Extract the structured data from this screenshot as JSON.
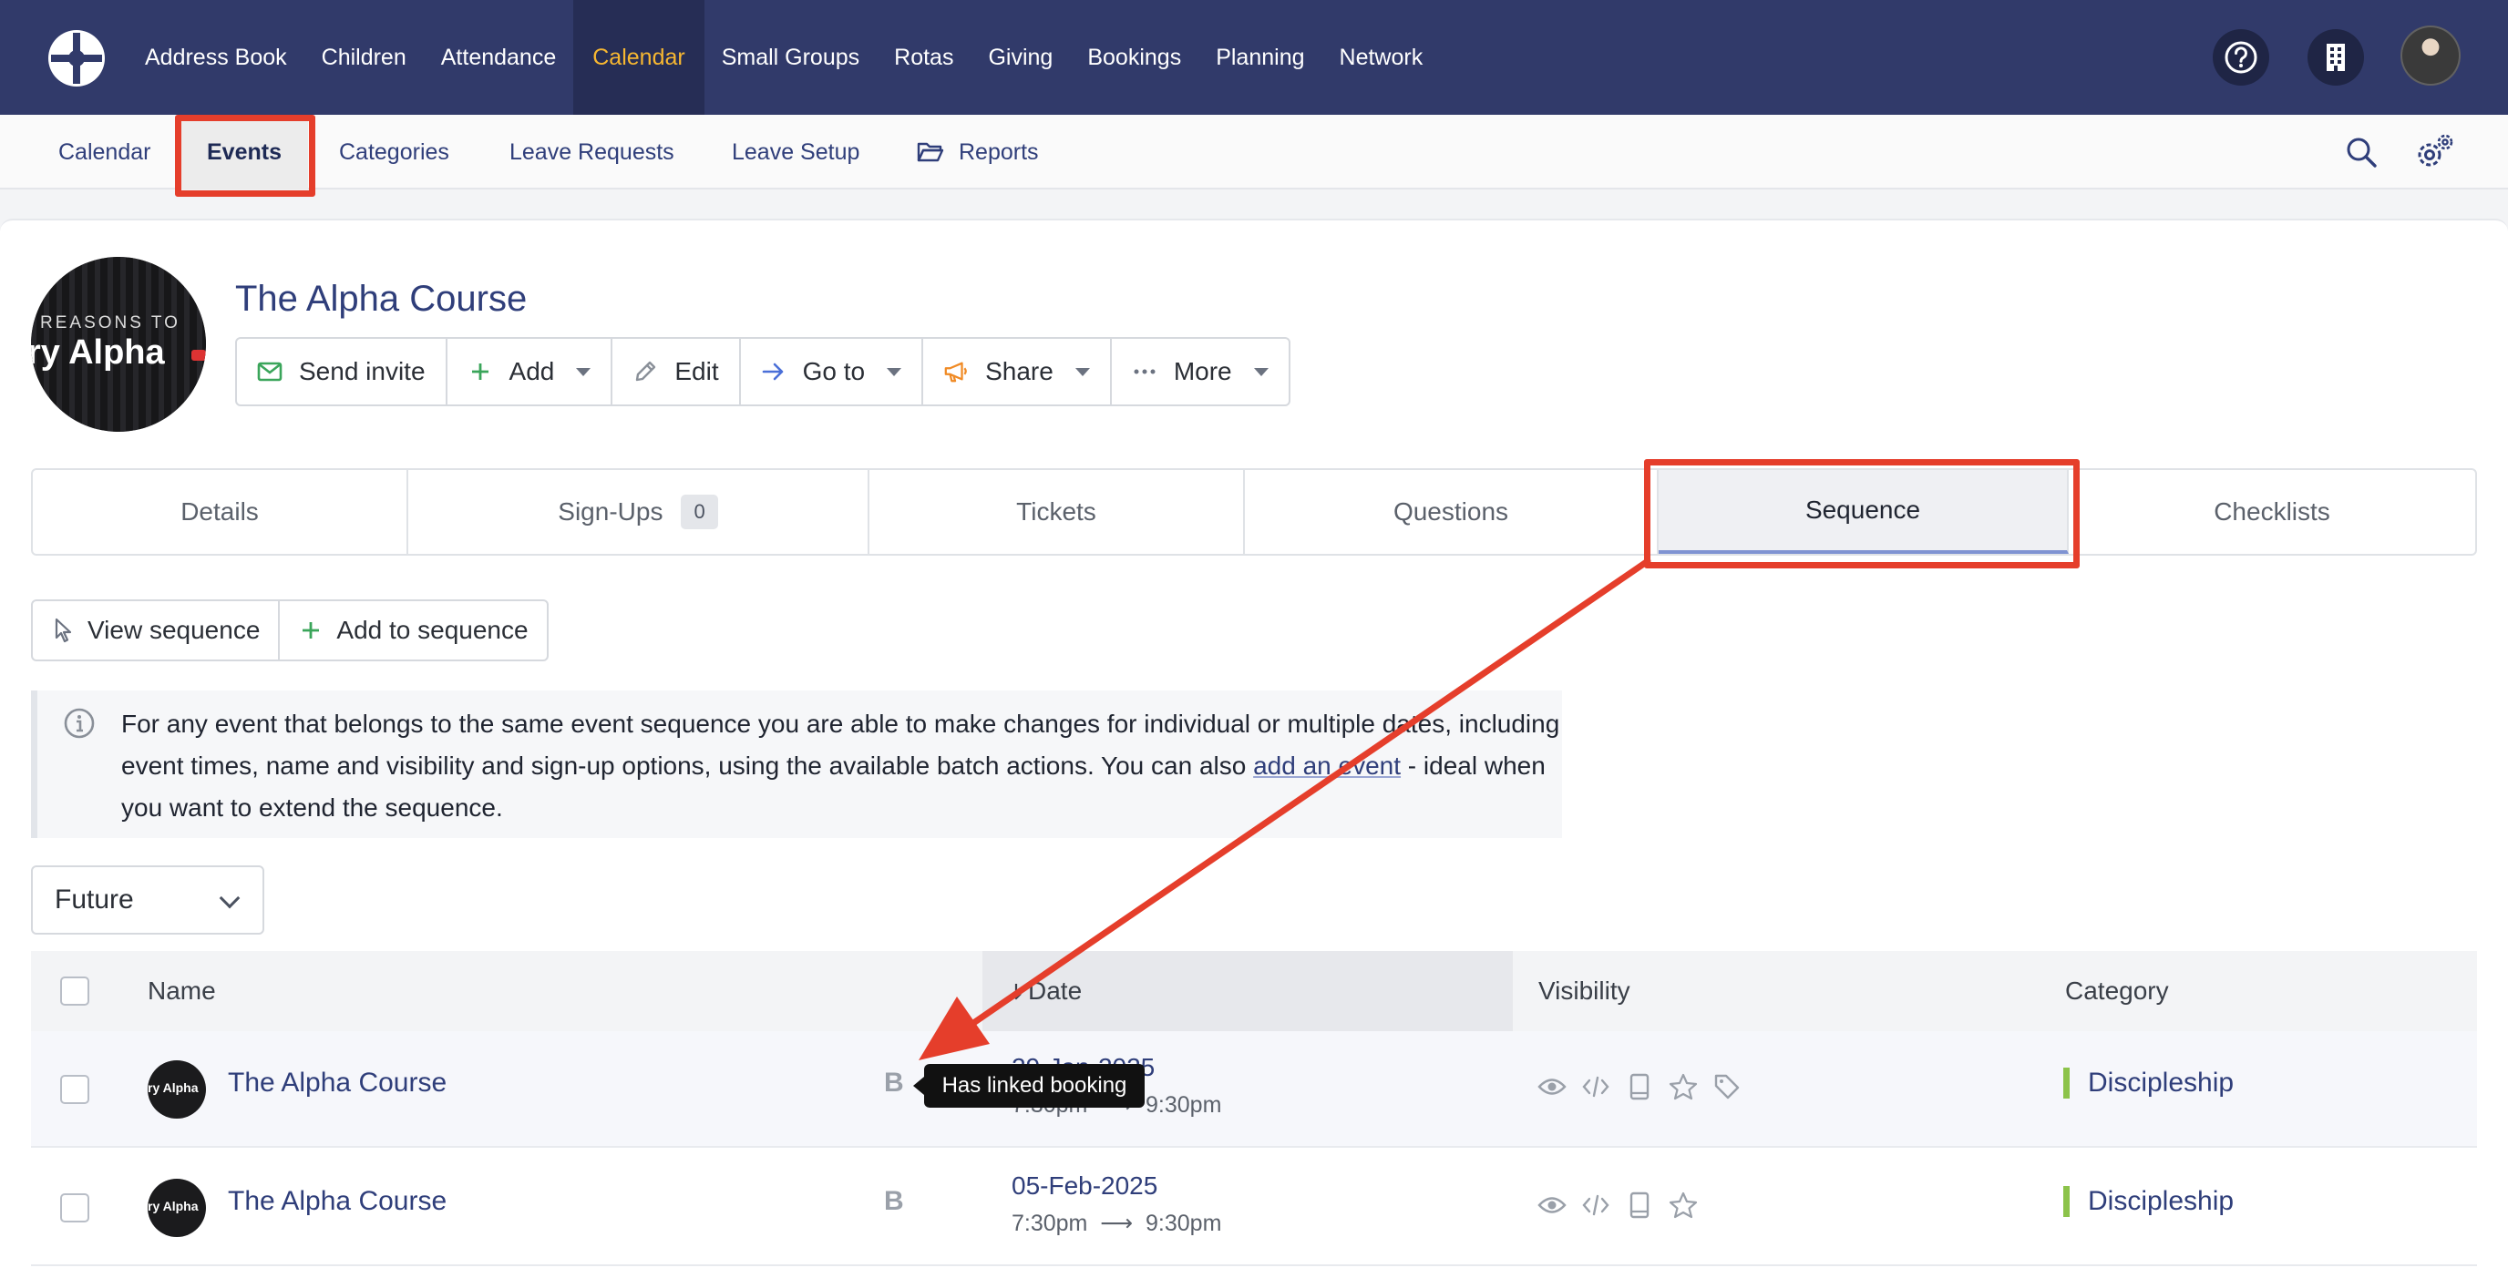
{
  "topnav": {
    "items": [
      "Address Book",
      "Children",
      "Attendance",
      "Calendar",
      "Small Groups",
      "Rotas",
      "Giving",
      "Bookings",
      "Planning",
      "Network"
    ],
    "active": "Calendar"
  },
  "subnav": {
    "items": [
      "Calendar",
      "Events",
      "Categories",
      "Leave Requests",
      "Leave Setup",
      "Reports"
    ],
    "active": "Events"
  },
  "event": {
    "title": "The Alpha Course",
    "avatar_text_1": "REASONS TO",
    "avatar_text_2": "ry Alpha"
  },
  "actions": {
    "send_invite": "Send invite",
    "add": "Add",
    "edit": "Edit",
    "go_to": "Go to",
    "share": "Share",
    "more": "More"
  },
  "tabs": {
    "details": "Details",
    "signups": "Sign-Ups",
    "signups_count": "0",
    "tickets": "Tickets",
    "questions": "Questions",
    "sequence": "Sequence",
    "checklists": "Checklists"
  },
  "sequence_actions": {
    "view": "View sequence",
    "add": "Add to sequence"
  },
  "info": {
    "text_1": "For any event that belongs to the same event sequence you are able to make changes for individual or multiple dates, including event times, name and visibility and sign-up options, using the available batch actions. You can also ",
    "link": "add an event",
    "text_2": " - ideal when you want to extend the sequence."
  },
  "filter": {
    "selected": "Future"
  },
  "table": {
    "headers": {
      "name": "Name",
      "date": "Date",
      "visibility": "Visibility",
      "category": "Category"
    },
    "rows": [
      {
        "name": "The Alpha Course",
        "badge": "B",
        "date": "29-Jan-2025",
        "start": "7:30pm",
        "end": "9:30pm",
        "category": "Discipleship",
        "avatar_text": "ry Alpha"
      },
      {
        "name": "The Alpha Course",
        "badge": "B",
        "date": "05-Feb-2025",
        "start": "7:30pm",
        "end": "9:30pm",
        "category": "Discipleship",
        "avatar_text": "ry Alpha"
      }
    ]
  },
  "tooltip": {
    "text": "Has linked booking"
  },
  "colors": {
    "nav_bg": "#313a6a",
    "nav_active_text": "#f7b731",
    "link": "#2f3e7a",
    "annotation_red": "#e53e2b",
    "category_green": "#8cc34a"
  }
}
